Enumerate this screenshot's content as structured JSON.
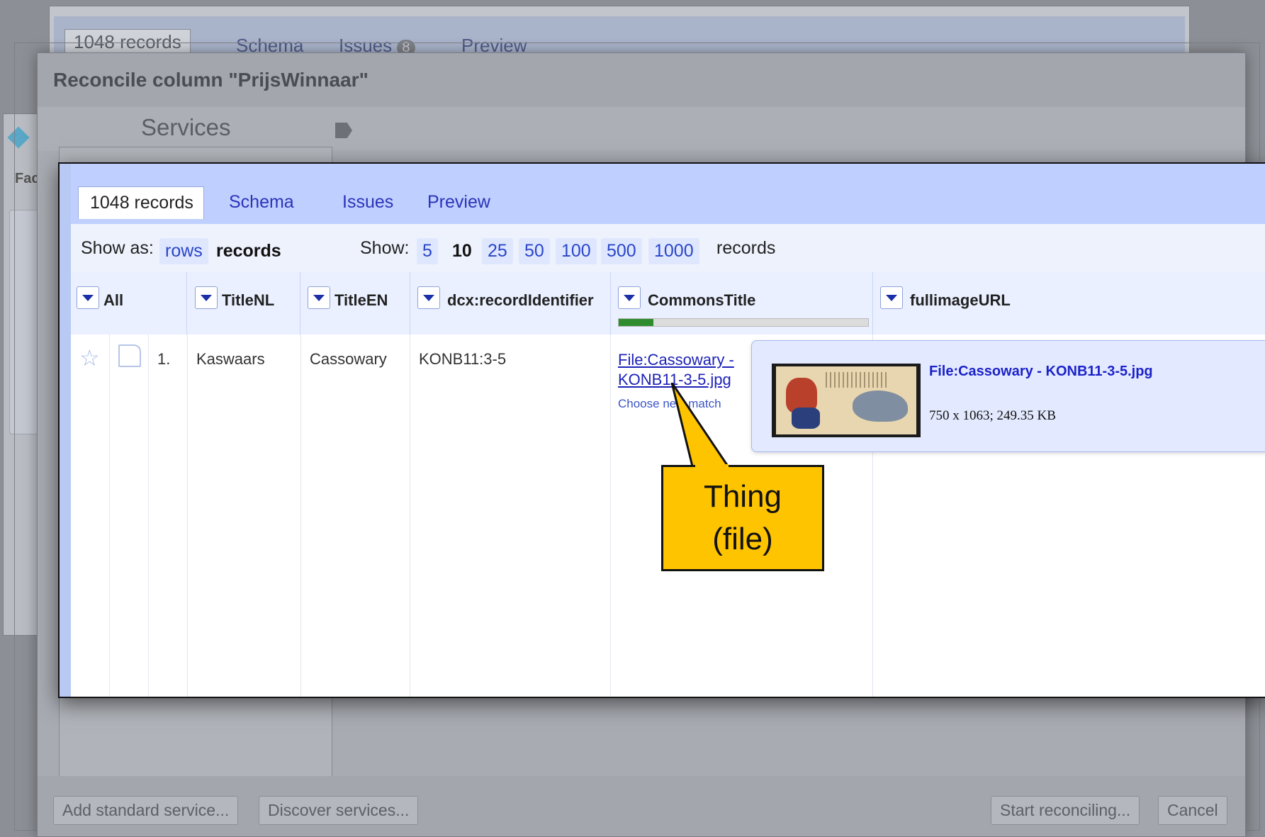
{
  "background": {
    "tabs": {
      "records": "1048 records",
      "schema": "Schema",
      "issues": "Issues",
      "issues_count": "8",
      "preview": "Preview"
    },
    "left_sidebar": {
      "label": "Fac"
    },
    "reconcile_dialog": {
      "title": "Reconcile column \"PrijsWinnaar\"",
      "services_label": "Services",
      "add_service_button": "Add standard service...",
      "discover_button": "Discover services...",
      "start_button": "Start reconciling...",
      "cancel_button": "Cancel"
    }
  },
  "front": {
    "tabs": {
      "records": "1048 records",
      "schema": "Schema",
      "issues": "Issues",
      "preview": "Preview"
    },
    "options": {
      "show_as_label": "Show as:",
      "rows": "rows",
      "records": "records",
      "show_label": "Show:",
      "counts": [
        "5",
        "10",
        "25",
        "50",
        "100",
        "500",
        "1000"
      ],
      "selected_count": "10",
      "records_suffix": "records"
    },
    "columns": [
      "All",
      "TitleNL",
      "TitleEN",
      "dcx:recordIdentifier",
      "CommonsTitle",
      "fullimageURL"
    ],
    "commons_progress": 0.14,
    "row": {
      "index": "1.",
      "title_nl": "Kaswaars",
      "title_en": "Cassowary",
      "identifier": "KONB11:3-5",
      "commons_link_1": "File:Cassowary -",
      "commons_link_2": "KONB11-3-5.jpg",
      "choose_match": "Choose new match"
    },
    "popup": {
      "title": "File:Cassowary - KONB11-3-5.jpg",
      "details": "750 x 1063; 249.35 KB"
    },
    "callout": {
      "line1": "Thing",
      "line2": "(file)"
    }
  },
  "colors": {
    "tab_bar": "#bfcfff",
    "link": "#1c22b8",
    "callout": "#ffc400",
    "progress": "#2e8b2e"
  }
}
